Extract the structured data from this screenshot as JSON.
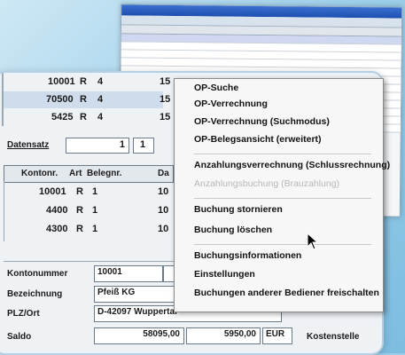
{
  "top_rows": [
    {
      "konto": "10001",
      "art": "R",
      "beleg": "4",
      "bel": "15"
    },
    {
      "konto": "70500",
      "art": "R",
      "beleg": "4",
      "bel": "15"
    },
    {
      "konto": "5425",
      "art": "R",
      "beleg": "4",
      "bel": "15"
    }
  ],
  "datensatz": {
    "label": "Datensatz",
    "value": "1",
    "total": "1"
  },
  "columns": {
    "kontonr": "Kontonr.",
    "art": "Art",
    "belegnr": "Belegnr.",
    "da": "Da"
  },
  "grid_rows": [
    {
      "konto": "10001",
      "art": "R",
      "beleg": "1",
      "bel": "10"
    },
    {
      "konto": "4400",
      "art": "R",
      "beleg": "1",
      "bel": "10"
    },
    {
      "konto": "4300",
      "art": "R",
      "beleg": "1",
      "bel": "10"
    }
  ],
  "form": {
    "kontonummer_label": "Kontonummer",
    "kontonummer_value": "10001",
    "bezeichnung_label": "Bezeichnung",
    "bezeichnung_value": "Pfeiß KG",
    "plzort_label": "PLZ/Ort",
    "plzort_value": "D-42097 Wuppertal",
    "saldo_label": "Saldo",
    "saldo_value": "58095,00",
    "saldo_value2": "5950,00",
    "currency": "EUR",
    "kostenstelle_label": "Kostenstelle"
  },
  "menu": {
    "items": [
      {
        "label": "OP-Suche",
        "disabled": false
      },
      {
        "label": "OP-Verrechnung",
        "disabled": false
      },
      {
        "label": "OP-Verrechnung (Suchmodus)",
        "disabled": false
      },
      {
        "label": "OP-Belegsansicht (erweitert)",
        "disabled": false
      },
      {
        "label": "Anzahlungsverrechnung (Schlussrechnung)",
        "disabled": false
      },
      {
        "label": "Anzahlungsbuchung (Brauzahlung)",
        "disabled": true
      },
      {
        "label": "Buchung stornieren",
        "disabled": false
      },
      {
        "label": "Buchung löschen",
        "disabled": false
      },
      {
        "label": "Buchungsinformationen",
        "disabled": false
      },
      {
        "label": "Einstellungen",
        "disabled": false
      },
      {
        "label": "Buchungen anderer Bediener freischalten",
        "disabled": false
      }
    ]
  }
}
